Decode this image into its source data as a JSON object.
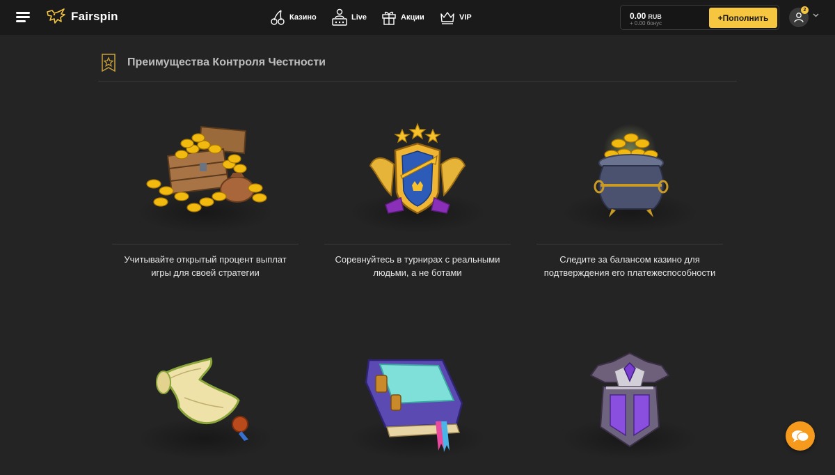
{
  "header": {
    "logo_text": "Fairspin",
    "nav": [
      {
        "label": "Казино",
        "icon": "cherry-icon"
      },
      {
        "label": "Live",
        "icon": "live-dealer-icon"
      },
      {
        "label": "Акции",
        "icon": "gift-icon"
      },
      {
        "label": "VIP",
        "icon": "crown-icon"
      }
    ],
    "balance": {
      "amount": "0.00",
      "currency": "RUB",
      "bonus": "+ 0.00 бонус"
    },
    "deposit_label": "+Пополнить",
    "notifications_count": "2"
  },
  "section": {
    "title": "Преимущества Контроля Честности",
    "icon": "star-badge-icon",
    "features": [
      {
        "icon": "treasure-chest-icon",
        "text": "Учитывайте открытый процент выплат игры для своей стратегии"
      },
      {
        "icon": "winged-shield-icon",
        "text": "Соревнуйтесь в турнирах с реальными людьми, а не ботами"
      },
      {
        "icon": "pot-of-gold-icon",
        "text": "Следите за балансом казино для подтверждения его платежеспособности"
      },
      {
        "icon": "scroll-icon",
        "text": ""
      },
      {
        "icon": "book-icon",
        "text": ""
      },
      {
        "icon": "armor-icon",
        "text": ""
      }
    ]
  },
  "colors": {
    "accent": "#f7c640",
    "background": "#242424",
    "header": "#1a1a1a",
    "chat": "#f59a1c"
  }
}
